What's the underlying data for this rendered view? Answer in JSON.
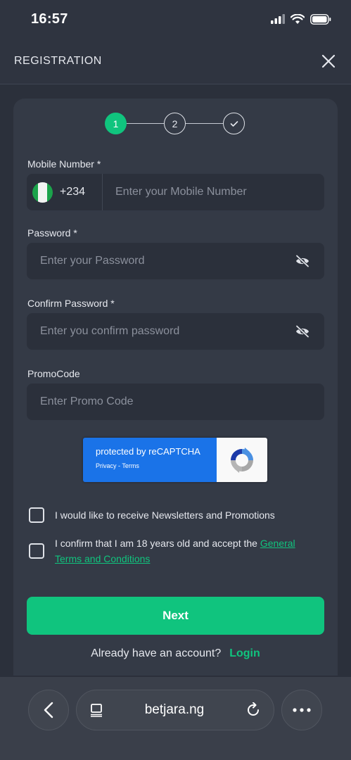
{
  "status_bar": {
    "time": "16:57"
  },
  "header": {
    "title": "REGISTRATION"
  },
  "stepper": {
    "steps": [
      "1",
      "2"
    ]
  },
  "form": {
    "mobile": {
      "label": "Mobile Number *",
      "dial_code": "+234",
      "placeholder": "Enter your Mobile Number"
    },
    "password": {
      "label": "Password *",
      "placeholder": "Enter your Password"
    },
    "confirm_password": {
      "label": "Confirm Password *",
      "placeholder": "Enter you confirm password"
    },
    "promo": {
      "label": "PromoCode",
      "placeholder": "Enter Promo Code"
    }
  },
  "recaptcha": {
    "main": "protected by reCAPTCHA",
    "links": "Privacy - Terms"
  },
  "checkboxes": {
    "newsletter": "I would like to receive Newsletters and Promotions",
    "age_prefix": "I confirm that I am 18 years old and accept the",
    "age_link": "General Terms and Conditions"
  },
  "next_button": "Next",
  "login": {
    "prompt": "Already have an account?",
    "link": "Login"
  },
  "browser": {
    "url": "betjara.ng"
  },
  "colors": {
    "accent": "#10c47e",
    "background": "#2b303b",
    "card": "#343a46",
    "recaptcha_blue": "#1a73e8"
  }
}
